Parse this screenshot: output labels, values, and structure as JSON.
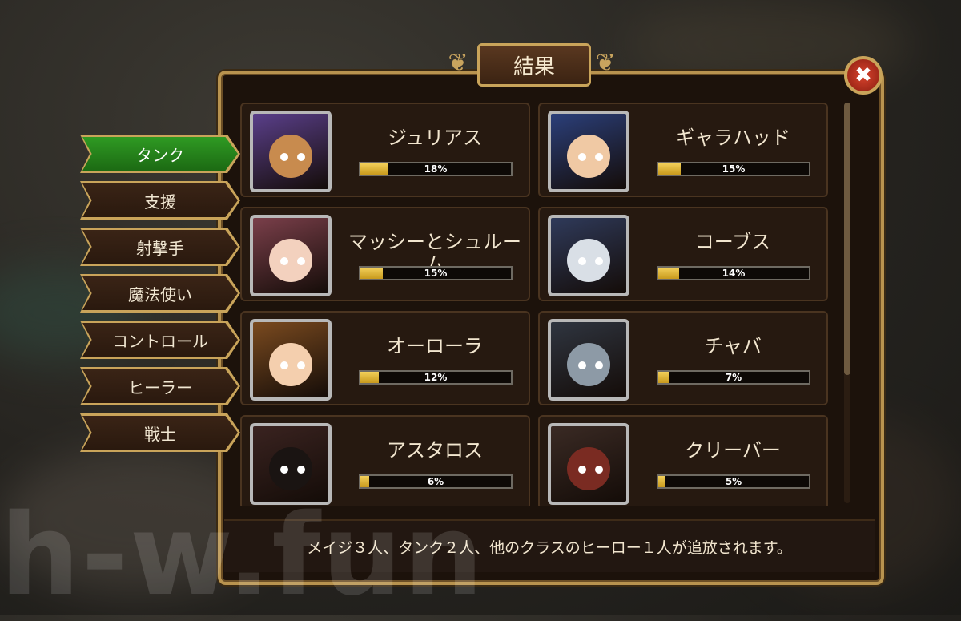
{
  "watermark": "h-w.fun",
  "title": "結果",
  "close_symbol": "✖",
  "tabs": [
    {
      "label": "タンク",
      "active": true
    },
    {
      "label": "支援",
      "active": false
    },
    {
      "label": "射撃手",
      "active": false
    },
    {
      "label": "魔法使い",
      "active": false
    },
    {
      "label": "コントロール",
      "active": false
    },
    {
      "label": "ヒーラー",
      "active": false
    },
    {
      "label": "戦士",
      "active": false
    }
  ],
  "heroes": [
    {
      "name": "ジュリアス",
      "percent": "18%",
      "value": 18,
      "bg": "#5a3f8a",
      "skin": "#c88b4e",
      "icon": "cat-hero-portrait"
    },
    {
      "name": "ギャラハッド",
      "percent": "15%",
      "value": 15,
      "bg": "#2b3f7a",
      "skin": "#f0c9a4",
      "icon": "knight-hero-portrait"
    },
    {
      "name": "マッシーとシュルーム",
      "percent": "15%",
      "value": 15,
      "bg": "#7a3f4a",
      "skin": "#f3d1be",
      "icon": "girl-hero-portrait"
    },
    {
      "name": "コーブス",
      "percent": "14%",
      "value": 14,
      "bg": "#2f3a5a",
      "skin": "#d9dfe6",
      "icon": "skeleton-hero-portrait"
    },
    {
      "name": "オーローラ",
      "percent": "12%",
      "value": 12,
      "bg": "#7a4a1f",
      "skin": "#f4cfae",
      "icon": "aurora-hero-portrait"
    },
    {
      "name": "チャバ",
      "percent": "7%",
      "value": 7,
      "bg": "#2f3540",
      "skin": "#8d9aa6",
      "icon": "beast-hero-portrait"
    },
    {
      "name": "アスタロス",
      "percent": "6%",
      "value": 6,
      "bg": "#3a2320",
      "skin": "#1a1412",
      "icon": "hooded-hero-portrait"
    },
    {
      "name": "クリーバー",
      "percent": "5%",
      "value": 5,
      "bg": "#3a2a24",
      "skin": "#7a2b22",
      "icon": "masked-hero-portrait"
    }
  ],
  "footer": "メイジ３人、タンク２人、他のクラスのヒーロー１人が追放されます。"
}
